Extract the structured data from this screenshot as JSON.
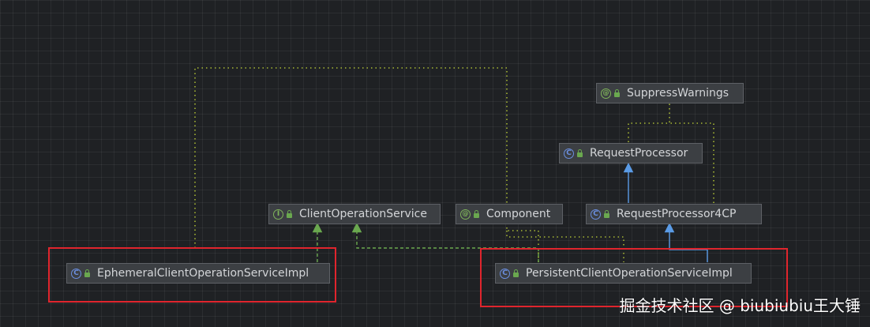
{
  "nodes": {
    "suppress_warnings": {
      "label": "SuppressWarnings",
      "kind": "annotation",
      "kind_glyph": "@"
    },
    "request_processor": {
      "label": "RequestProcessor",
      "kind": "class",
      "kind_glyph": "C"
    },
    "request_processor_4cp": {
      "label": "RequestProcessor4CP",
      "kind": "class",
      "kind_glyph": "C"
    },
    "client_operation_service": {
      "label": "ClientOperationService",
      "kind": "interface",
      "kind_glyph": "I"
    },
    "component": {
      "label": "Component",
      "kind": "annotation",
      "kind_glyph": "@"
    },
    "ephemeral_impl": {
      "label": "EphemeralClientOperationServiceImpl",
      "kind": "class",
      "kind_glyph": "C"
    },
    "persistent_impl": {
      "label": "PersistentClientOperationServiceImpl",
      "kind": "class",
      "kind_glyph": "C"
    }
  },
  "edges": [
    {
      "from": "EphemeralClientOperationServiceImpl",
      "to": "ClientOperationService",
      "type": "implements"
    },
    {
      "from": "PersistentClientOperationServiceImpl",
      "to": "ClientOperationService",
      "type": "implements"
    },
    {
      "from": "RequestProcessor4CP",
      "to": "RequestProcessor",
      "type": "extends"
    },
    {
      "from": "PersistentClientOperationServiceImpl",
      "to": "RequestProcessor4CP",
      "type": "extends"
    },
    {
      "from": "EphemeralClientOperationServiceImpl",
      "to": "Component",
      "type": "annotated"
    },
    {
      "from": "PersistentClientOperationServiceImpl",
      "to": "Component",
      "type": "annotated"
    },
    {
      "from": "RequestProcessor",
      "to": "SuppressWarnings",
      "type": "annotated"
    },
    {
      "from": "RequestProcessor4CP",
      "to": "SuppressWarnings",
      "type": "annotated"
    }
  ],
  "colors": {
    "background": "#1f2124",
    "node_fill": "#3c3f43",
    "annotation_edge": "#a7b834",
    "implements_edge": "#6aa84f",
    "extends_edge": "#5a9be6",
    "highlight": "#e0252d"
  },
  "icons": {
    "class": "class-icon",
    "interface": "interface-icon",
    "annotation": "annotation-icon",
    "visibility": "lock-icon"
  },
  "watermark": "掘金技术社区 @ biubiubiu王大锤"
}
